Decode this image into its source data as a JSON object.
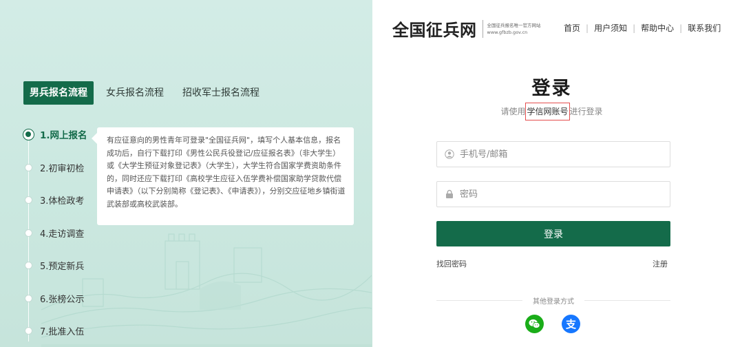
{
  "tabs": [
    "男兵报名流程",
    "女兵报名流程",
    "招收军士报名流程"
  ],
  "steps": [
    "1.网上报名",
    "2.初审初检",
    "3.体检政考",
    "4.走访调查",
    "5.预定新兵",
    "6.张榜公示",
    "7.批准入伍"
  ],
  "info_text": "有应征意向的男性青年可登录\"全国征兵网\"，填写个人基本信息，报名成功后，自行下载打印《男性公民兵役登记/应征报名表》（非大学生）或《大学生预征对象登记表》（大学生），大学生符合国家学费资助条件的，同时还应下载打印《高校学生应征入伍学费补偿国家助学贷款代偿申请表》（以下分别简称《登记表》、《申请表》），分别交应征地乡镇街道武装部或高校武装部。",
  "header": {
    "logo_text": "全国征兵网",
    "logo_sub1": "全国征兵报名唯一官方网站",
    "logo_sub2": "www.gfbzb.gov.cn",
    "nav": [
      "首页",
      "用户须知",
      "帮助中心",
      "联系我们"
    ]
  },
  "login": {
    "title": "登录",
    "subtitle_pre": "请使用",
    "subtitle_highlight": "学信网账号",
    "subtitle_post": "进行登录",
    "phone_placeholder": "手机号/邮箱",
    "password_placeholder": "密码",
    "button_label": "登录",
    "forgot_label": "找回密码",
    "register_label": "注册",
    "other_methods_label": "其他登录方式",
    "alipay_glyph": "支"
  },
  "colors": {
    "primary": "#146b4a",
    "highlight_border": "#e44c4c",
    "wechat": "#1aad19",
    "alipay": "#1677ff"
  },
  "icons": [
    "user-icon",
    "lock-icon",
    "wechat-icon",
    "alipay-icon"
  ]
}
